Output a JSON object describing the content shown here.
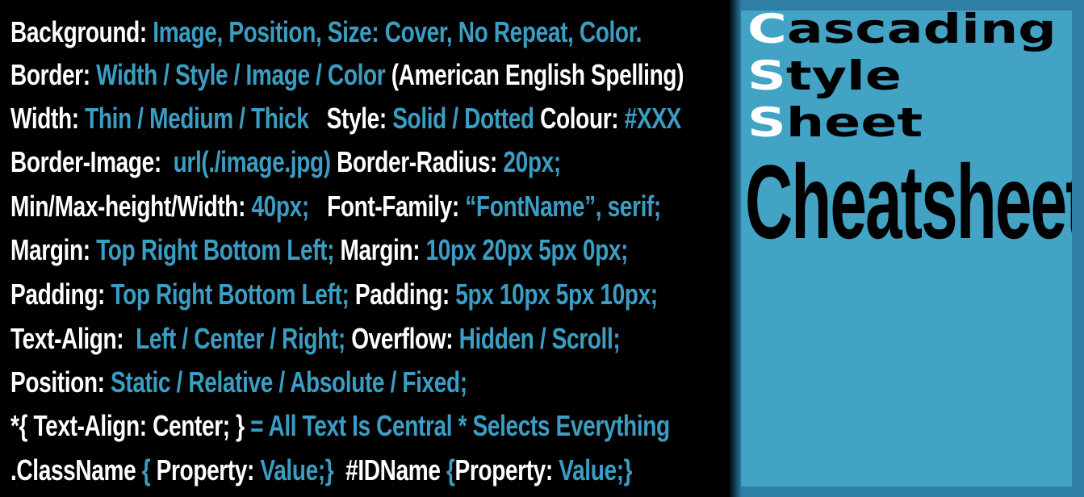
{
  "colors": {
    "background": "#000000",
    "text": "#ffffff",
    "accent": "#3b9dc2",
    "panel": "#42a3c4",
    "panel_border": "#2f7fa5"
  },
  "lines": [
    [
      {
        "t": "Background: ",
        "c": "w"
      },
      {
        "t": "Image, Position, Size: Cover, No Repeat, Color.",
        "c": "b"
      }
    ],
    [
      {
        "t": "Border: ",
        "c": "w"
      },
      {
        "t": "Width / Style / Image / Color ",
        "c": "b"
      },
      {
        "t": "(American English Spelling)",
        "c": "w"
      }
    ],
    [
      {
        "t": "Width: ",
        "c": "w"
      },
      {
        "t": "Thin / Medium / Thick",
        "c": "b"
      },
      {
        "t": "   Style: ",
        "c": "w"
      },
      {
        "t": "Solid / Dotted ",
        "c": "b"
      },
      {
        "t": "Colour: ",
        "c": "w"
      },
      {
        "t": "#XXX",
        "c": "b"
      }
    ],
    [
      {
        "t": "Border-Image:  ",
        "c": "w"
      },
      {
        "t": "url(./image.jpg) ",
        "c": "b"
      },
      {
        "t": "Border-Radius: ",
        "c": "w"
      },
      {
        "t": "20px;",
        "c": "b"
      }
    ],
    [
      {
        "t": "Min/Max-height/Width: ",
        "c": "w"
      },
      {
        "t": "40px;",
        "c": "b"
      },
      {
        "t": "   Font-Family: ",
        "c": "w"
      },
      {
        "t": "“FontName”, serif;",
        "c": "b"
      }
    ],
    [
      {
        "t": "Margin: ",
        "c": "w"
      },
      {
        "t": "Top Right Bottom Left; ",
        "c": "b"
      },
      {
        "t": "Margin: ",
        "c": "w"
      },
      {
        "t": "10px 20px 5px 0px;",
        "c": "b"
      }
    ],
    [
      {
        "t": "Padding: ",
        "c": "w"
      },
      {
        "t": "Top Right Bottom Left; ",
        "c": "b"
      },
      {
        "t": "Padding: ",
        "c": "w"
      },
      {
        "t": "5px 10px 5px 10px;",
        "c": "b"
      }
    ],
    [
      {
        "t": "Text-Align:  ",
        "c": "w"
      },
      {
        "t": "Left / Center / Right; ",
        "c": "b"
      },
      {
        "t": "Overflow: ",
        "c": "w"
      },
      {
        "t": "Hidden / Scroll;",
        "c": "b"
      }
    ],
    [
      {
        "t": "Position: ",
        "c": "w"
      },
      {
        "t": "Static / Relative / Absolute / Fixed;",
        "c": "b"
      }
    ],
    [
      {
        "t": "*{ Text-Align: Center; } ",
        "c": "w"
      },
      {
        "t": "= All Text Is Central * Selects Everything",
        "c": "b"
      }
    ],
    [
      {
        "t": ".ClassName ",
        "c": "w"
      },
      {
        "t": "{ ",
        "c": "b"
      },
      {
        "t": "Property: ",
        "c": "w"
      },
      {
        "t": "Value;}",
        "c": "b"
      },
      {
        "t": "  #IDName ",
        "c": "w"
      },
      {
        "t": "{",
        "c": "b"
      },
      {
        "t": "Property: ",
        "c": "w"
      },
      {
        "t": "Value;}",
        "c": "b"
      }
    ]
  ],
  "title": {
    "w1_cap": "C",
    "w1_rest": "ascading",
    "w2_cap": "S",
    "w2_rest": "tyle",
    "w3_cap": "S",
    "w3_rest": "heet",
    "w4": "Cheatsheet"
  }
}
